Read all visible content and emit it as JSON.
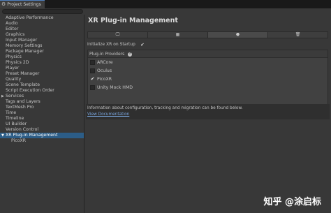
{
  "window": {
    "tab_title": "Project Settings",
    "icon": "gear-icon"
  },
  "sidebar": {
    "items": [
      {
        "label": "Adaptive Performance"
      },
      {
        "label": "Audio"
      },
      {
        "label": "Editor"
      },
      {
        "label": "Graphics"
      },
      {
        "label": "Input Manager"
      },
      {
        "label": "Memory Settings"
      },
      {
        "label": "Package Manager"
      },
      {
        "label": "Physics"
      },
      {
        "label": "Physics 2D"
      },
      {
        "label": "Player"
      },
      {
        "label": "Preset Manager"
      },
      {
        "label": "Quality"
      },
      {
        "label": "Scene Template"
      },
      {
        "label": "Script Execution Order"
      },
      {
        "label": "Services"
      },
      {
        "label": "Tags and Layers"
      },
      {
        "label": "TextMesh Pro"
      },
      {
        "label": "Time"
      },
      {
        "label": "Timeline"
      },
      {
        "label": "UI Builder"
      },
      {
        "label": "Version Control"
      },
      {
        "label": "XR Plug-in Management"
      },
      {
        "label": "PicoXR"
      }
    ],
    "selected": "XR Plug-in Management"
  },
  "main": {
    "title": "XR Plug-in Management",
    "platform_tabs": [
      {
        "icon": "monitor-icon",
        "glyph": "🖵"
      },
      {
        "icon": "grid-icon",
        "glyph": "▦"
      },
      {
        "icon": "android-icon",
        "glyph": "⬣"
      },
      {
        "icon": "trash-icon",
        "glyph": "🗑"
      }
    ],
    "active_tab": 2,
    "init_label": "Initialize XR on Startup",
    "init_checked": true,
    "providers": {
      "label": "Plug-in Providers",
      "help_glyph": "?",
      "items": [
        {
          "label": "ARCore",
          "checked": false
        },
        {
          "label": "Oculus",
          "checked": false
        },
        {
          "label": "PicoXR",
          "checked": true
        },
        {
          "label": "Unity Mock HMD",
          "checked": false
        }
      ]
    },
    "info_text": "Information about configuration, tracking and migration can be found below.",
    "info_link": "View Documentation"
  },
  "watermark": "知乎 @涂启标",
  "colors": {
    "background": "#383838",
    "selection": "#2c5d87",
    "link": "#7aa7e0"
  }
}
